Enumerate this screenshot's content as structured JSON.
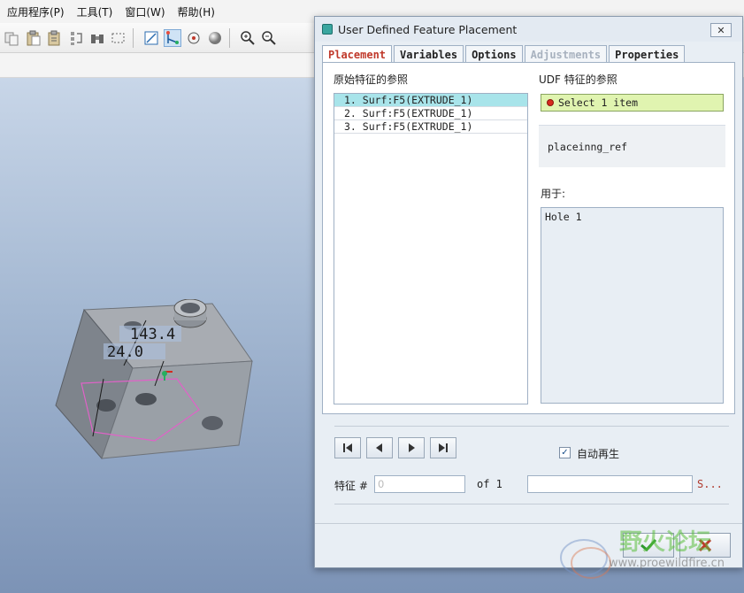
{
  "menubar": {
    "items": [
      "应用程序(P)",
      "工具(T)",
      "窗口(W)",
      "帮助(H)"
    ]
  },
  "toolbar": {
    "icons": [
      "copy-icon",
      "paste-icon",
      "paste-special-icon",
      "regenerate-icon",
      "binoculars-icon",
      "selection-box-icon",
      "view-display-icon",
      "datum-points-icon",
      "spin-center-icon",
      "shading-icon",
      "zoom-in-icon",
      "zoom-out-icon"
    ]
  },
  "model": {
    "dimension_1": "143.4",
    "dimension_2": "24.0"
  },
  "dialog": {
    "title": "User Defined Feature Placement",
    "close_label": "✕",
    "tabs": [
      {
        "label": "Placement",
        "state": "active"
      },
      {
        "label": "Variables",
        "state": "normal"
      },
      {
        "label": "Options",
        "state": "normal"
      },
      {
        "label": "Adjustments",
        "state": "disabled"
      },
      {
        "label": "Properties",
        "state": "normal"
      }
    ],
    "placement": {
      "orig_refs_label": "原始特征的参照",
      "orig_refs": [
        "1. Surf:F5(EXTRUDE_1)",
        "2. Surf:F5(EXTRUDE_1)",
        "3. Surf:F5(EXTRUDE_1)"
      ],
      "udf_refs_label": "UDF 特征的参照",
      "select_prompt": "Select 1 item",
      "ref_name": "placeinng_ref",
      "used_for_label": "用于:",
      "used_for_value": "Hole 1"
    },
    "auto_regen_label": "自动再生",
    "auto_regen_checked": true,
    "feature_label": "特征 #",
    "feature_value": "0",
    "of_label": "of 1",
    "search_value": "",
    "search_button": "S...",
    "colors": {
      "active_tab_text": "#c0392b",
      "select_box": "#e0f4b0",
      "selected_row": "#a8e4ea",
      "ok_check": "#2e9a2e",
      "cancel_x": "#c0392b"
    }
  },
  "watermark": {
    "text": "野火论坛",
    "url": "www.proewildfire.cn"
  }
}
